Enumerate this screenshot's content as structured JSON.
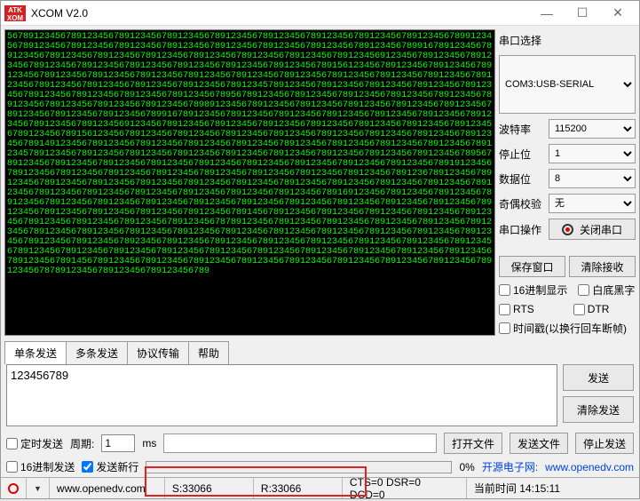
{
  "window": {
    "title": "XCOM V2.0"
  },
  "terminal": {
    "pattern": "56789123456789123456789123456789123456789123456789123456789123456789123456789123456789912345678912345678912345678912345678912345678912345678912345678912345678912345678991678912345678912345678912345678912345678912345678912345678912345678912345678912345691234567891234567891234567891234567891234567891234567891234567891234567891234567891561234567891234567891234567891234567891234567891234567891234567891234567891234567891234567891234567891234567891234567891234567891234567891234567891234567891234567891234578912345678912345678912345678912345678912345678912345678912345678912345678912345678956789123456789123456789123456789123456789123456789123456789123456789123456789123456789891234567891234567891234567891234567891234567891234567891234567891234567891234567899167891234567891234567891234567891234567891234567891234567891234567891234567891234569123456789123456789123456789123456789123456789123456789123456789123456789123456789156123456789123456789123456789123456789123456789123456789123456789123456789123456789149123456789123456789123456789123456789123456789123456789123456789123456789123456789123457891234567891234567891234567891234567891234567891234567891234567891234567891234567895678912345678912345678912345678912345678912345678912345678912345678912345678912345678919123456789123456789123456789123456789123456789123456789123456789123456789123456789123678912345678912345678912345678912345678912345678912345678912345678912345678912345678912345678912345678912345678912345678912345678912345678912345678912345678912345678916912345678912345678912345678912345678912345678912345678912345678912345678912345678912345678912345678912345678912345678912345678912345678912345678912345678912345678914567891234567891234567891234567891234567891234567891234567891234567891234567891234567878912345678912345678912345678912345678912345678912345678912345678912345678912345678912345678912345678912345678912345678912345678912345678912345678912345678912345678923456789123456789123456789123456789123456789123456789123456789123456789123456789123456789123456789123456789123456789123456789123456789123456789123456789123456789123456789145678912345678912345678912345678912345678912345678912345678912345678912345678912345678789123456789123456789123456789"
  },
  "side": {
    "port_label": "串口选择",
    "port_value": "COM3:USB-SERIAL",
    "baud_label": "波特率",
    "baud_value": "115200",
    "stop_label": "停止位",
    "stop_value": "1",
    "data_label": "数据位",
    "data_value": "8",
    "parity_label": "奇偶校验",
    "parity_value": "无",
    "op_label": "串口操作",
    "close_btn": "关闭串口",
    "save_btn": "保存窗口",
    "clear_btn": "清除接收",
    "hex_disp": "16进制显示",
    "white_bg": "白底黑字",
    "rts": "RTS",
    "dtr": "DTR",
    "timestamp": "时间戳(以换行回车断帧)"
  },
  "tabs": {
    "single": "单条发送",
    "multi": "多条发送",
    "proto": "协议传输",
    "help": "帮助"
  },
  "send": {
    "text": "123456789",
    "send_btn": "发送",
    "clear_btn": "清除发送"
  },
  "opts": {
    "timed": "定时发送",
    "period_lbl": "周期:",
    "period_val": "1",
    "ms": "ms",
    "open_file": "打开文件",
    "send_file": "发送文件",
    "stop_send": "停止发送",
    "hex_send": "16进制发送",
    "send_newline": "发送新行",
    "zero_pct": "0%",
    "link_text": "开源电子网:",
    "link_url": "www.openedv.com"
  },
  "status": {
    "url": "www.openedv.com",
    "s": "S:33066",
    "r": "R:33066",
    "cts": "CTS=0 DSR=0 DCD=0",
    "time_lbl": "当前时间 14:15:11"
  }
}
